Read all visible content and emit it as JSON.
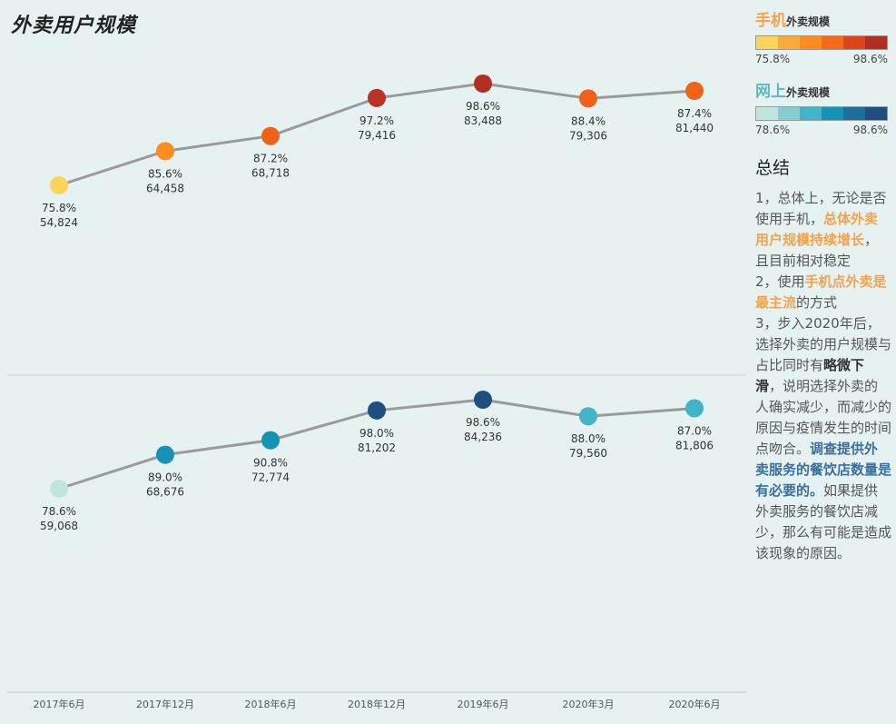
{
  "page": {
    "title": "外卖用户规模"
  },
  "chart_data": [
    {
      "type": "line",
      "name": "手机外卖规模",
      "categories": [
        "2017年6月",
        "2017年12月",
        "2018年6月",
        "2018年12月",
        "2019年6月",
        "2020年3月",
        "2020年6月"
      ],
      "values": [
        54824,
        64458,
        68718,
        79416,
        83488,
        79306,
        81440
      ],
      "percent_labels": [
        "75.8%",
        "85.6%",
        "87.2%",
        "97.2%",
        "98.6%",
        "88.4%",
        "87.4%"
      ],
      "value_labels": [
        "54,824",
        "64,458",
        "68,718",
        "79,416",
        "83,488",
        "79,306",
        "81,440"
      ],
      "point_colors": [
        "#fdd45a",
        "#fb8c1e",
        "#f0621a",
        "#b73424",
        "#b02e22",
        "#f0621a",
        "#f0621a"
      ],
      "line_color": "#9a9a9a",
      "ylim": [
        50000,
        87000
      ]
    },
    {
      "type": "line",
      "name": "网上外卖规模",
      "categories": [
        "2017年6月",
        "2017年12月",
        "2018年6月",
        "2018年12月",
        "2019年6月",
        "2020年3月",
        "2020年6月"
      ],
      "values": [
        59068,
        68676,
        72774,
        81202,
        84236,
        79560,
        81806
      ],
      "percent_labels": [
        "78.6%",
        "89.0%",
        "90.8%",
        "98.0%",
        "98.6%",
        "88.0%",
        "87.0%"
      ],
      "value_labels": [
        "59,068",
        "68,676",
        "72,774",
        "81,202",
        "84,236",
        "79,560",
        "81,806"
      ],
      "point_colors": [
        "#bfe6dd",
        "#1493b4",
        "#1493b4",
        "#1f4e80",
        "#1f4e80",
        "#43b3c8",
        "#43b3c8"
      ],
      "line_color": "#9a9a9a",
      "ylim": [
        50000,
        87000
      ]
    }
  ],
  "legend": {
    "mobile": {
      "big": "手机",
      "small": "外卖规模",
      "color": "#f7a24a",
      "swatches": [
        "#fdd45a",
        "#fcaa3a",
        "#fb8c1e",
        "#f56a18",
        "#d9451c",
        "#b02e22"
      ],
      "min": "75.8%",
      "max": "98.6%"
    },
    "online": {
      "big": "网上",
      "small": "外卖规模",
      "color": "#5fb8c2",
      "swatches": [
        "#bfe6dd",
        "#86ccd0",
        "#43b3c8",
        "#1493b4",
        "#1b6f9a",
        "#1f4e80"
      ],
      "min": "78.6%",
      "max": "98.6%"
    }
  },
  "summary": {
    "title": "总结",
    "p1_a": "1，总体上，无论是否使用手机，",
    "p1_hl": "总体外卖用户规模持续增长",
    "p1_b": "，且目前相对稳定",
    "p2_a": "2，使用",
    "p2_hl": "手机点外卖是最主流",
    "p2_b": "的方式",
    "p3_a": "3，步入2020年后，选择外卖的用户规模与占比同时有",
    "p3_hl": "略微下滑",
    "p3_b": "，说明选择外卖的人确实减少，而减少的原因与疫情发生的时间点吻合。",
    "p3_hl2": "调查提供外卖服务的餐饮店数量是有必要的。",
    "p3_c": "如果提供外卖服务的餐饮店减少，那么有可能是造成该现象的原因。"
  }
}
